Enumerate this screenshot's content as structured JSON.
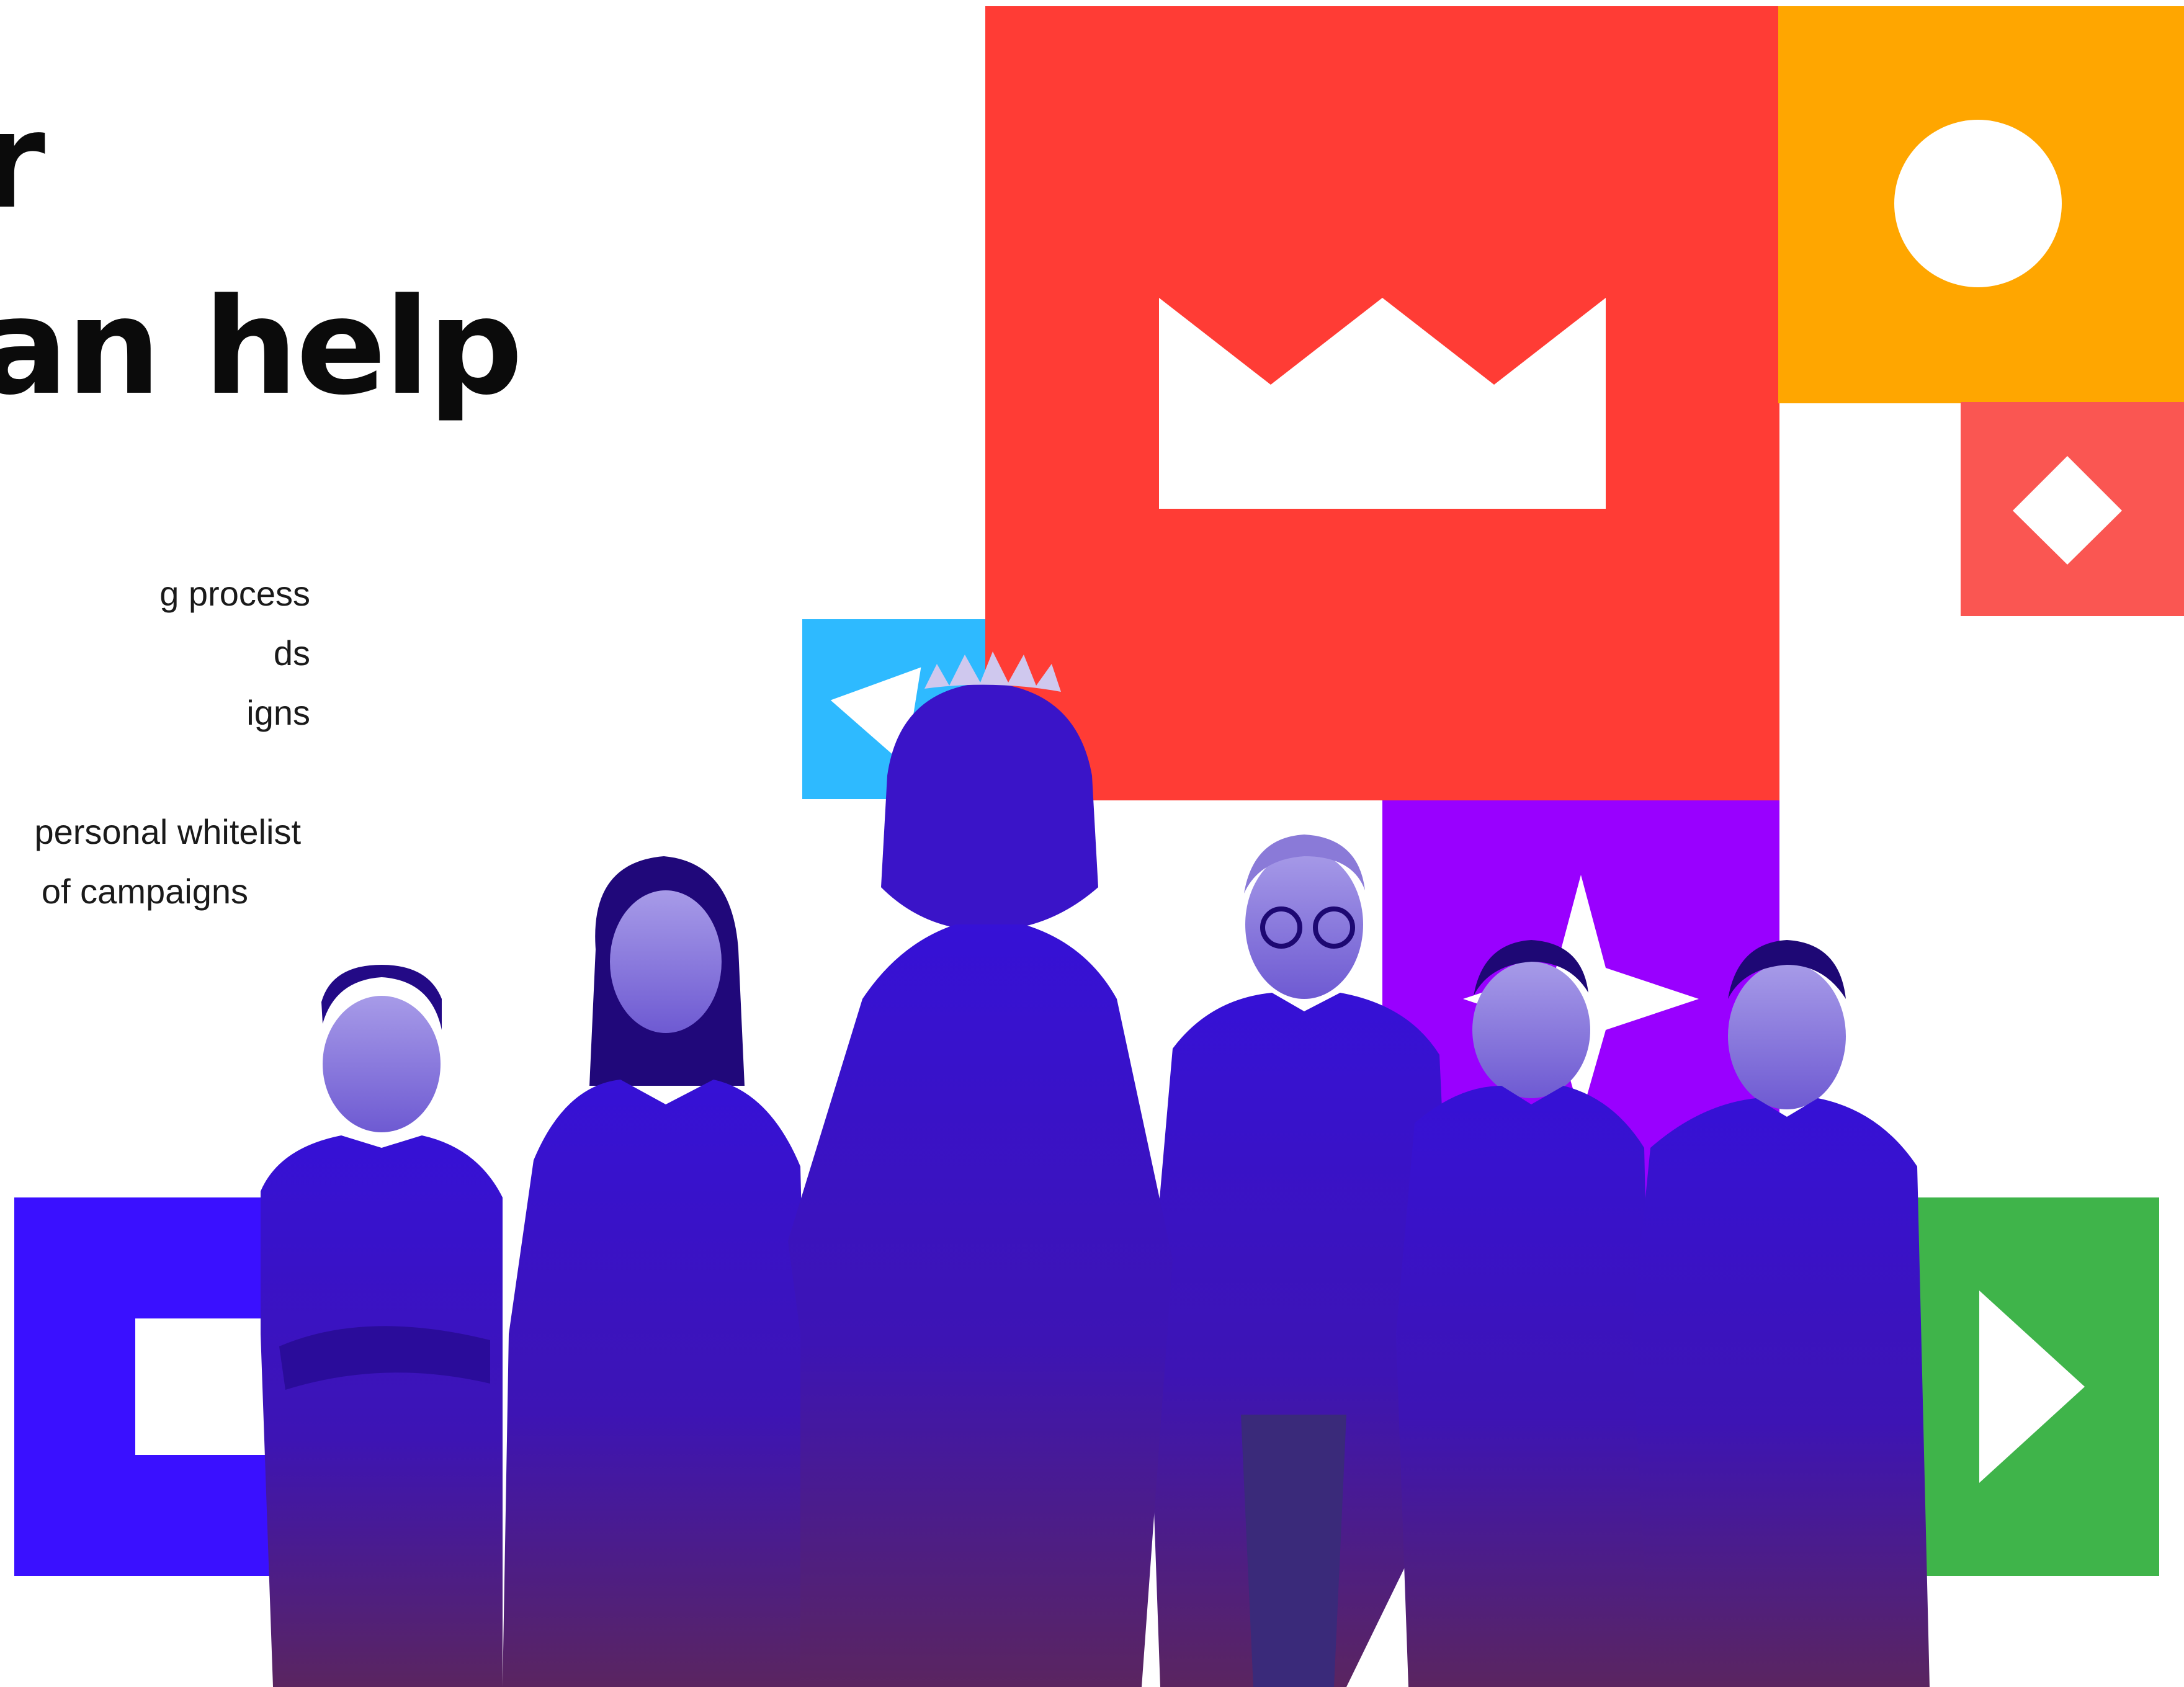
{
  "headline": {
    "line1": "r",
    "line2": "can help"
  },
  "bullets": [
    "g process",
    "ds",
    "igns",
    "personal whitelist",
    "of campaigns"
  ],
  "colors": {
    "red_tile": "#ff3c35",
    "orange_tile": "#ffa600",
    "coral_tile": "#fa5652",
    "cyan_tile": "#2ebaff",
    "purple_tile": "#9900ff",
    "blue_tile": "#3a10ff",
    "green_tile": "#3fb44a",
    "figure_top": "#3611d6",
    "figure_bottom": "#5a2560",
    "white": "#ffffff",
    "text": "#0b0b0b"
  },
  "icons": {
    "red_tile": "crown-icon",
    "orange_tile": "circle-icon",
    "coral_tile": "diamond-icon",
    "cyan_tile": "triangle-icon",
    "purple_tile": "four-point-star-icon",
    "blue_tile": "square-icon",
    "green_tile": "play-arrow-icon"
  },
  "team": [
    "person-1",
    "person-2",
    "person-with-tiara-silhouette",
    "person-4",
    "person-5",
    "person-6"
  ]
}
